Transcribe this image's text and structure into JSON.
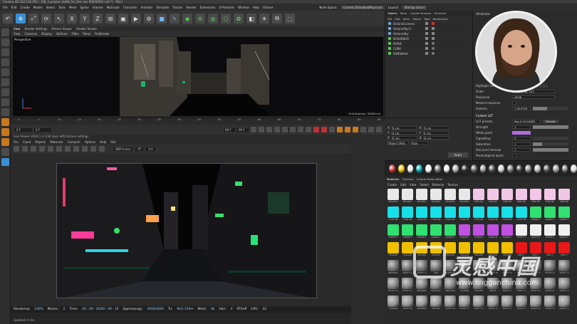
{
  "window": {
    "title": "Cinema 4D S22.116 (RC) - [08_3_project_Vol08_for_Dec.aec 00000002.c4d *] - Main"
  },
  "menubar": {
    "items": [
      "File",
      "Edit",
      "Create",
      "Modes",
      "Select",
      "Tools",
      "Mesh",
      "Spline",
      "Volume",
      "MoGraph",
      "Character",
      "Animate",
      "Simulate",
      "Tracker",
      "Render",
      "Extensions",
      "O-Particles",
      "Window",
      "Help",
      "Octane"
    ],
    "right": [
      "Node Space:",
      "Current (Standard/Physical)",
      "Layout:",
      "Startup (User)"
    ]
  },
  "viewport": {
    "tabs": [
      "View",
      "Render Settings",
      "Picture Viewer",
      "Shader Viewer"
    ],
    "menu": [
      "View",
      "Cameras",
      "Display",
      "Options",
      "Filter",
      "Panel",
      "ProRender"
    ],
    "label": "Perspective",
    "grid_spacing": "Grid Spacing : 50000 cm"
  },
  "timeline": {
    "ticks": [
      "0",
      "5",
      "10",
      "15",
      "20",
      "25",
      "30",
      "35",
      "40",
      "45",
      "50",
      "55",
      "60",
      "65",
      "70",
      "75",
      "80",
      "85",
      "90"
    ],
    "start": "0 F",
    "current": "0 F",
    "end": "90 F",
    "end2": "90 F"
  },
  "live_viewer": {
    "title": "Live Viewer 2020.1.4 (234 days left)    Octane settings",
    "menu": [
      "File",
      "Cloud",
      "Objects",
      "Materials",
      "Compare",
      "Options",
      "Help",
      "GUI"
    ],
    "mode": "HDR linear",
    "pt": "PT",
    "val": "0.6"
  },
  "status": {
    "rendering_label": "Rendering:",
    "rendering": "100%",
    "mssec_label": "Ms/sec:",
    "mssec": "0",
    "time_label": "Time:",
    "time": "00 : 09 : 26/00 : 09 : 26",
    "spp_label": "Spp/maxspp:",
    "spp": "4000/4000",
    "tri_label": "Tri:",
    "tri": "9k/1.529m",
    "mesh_label": "Mesh:",
    "mesh": "8k",
    "hair_label": "Hair:",
    "hair": "0",
    "rtx_label": "RTXoff",
    "gpu_label": "GPU:",
    "gpu": "82",
    "footer": "Updated: 0 ms."
  },
  "objects": {
    "tabs": [
      "Objects",
      "Takes",
      "Content Browser",
      "Structure"
    ],
    "menu": [
      "File",
      "Edit",
      "View",
      "Object",
      "Tags",
      "Bookmarks"
    ],
    "rows": [
      {
        "name": "OctaneCamera"
      },
      {
        "name": "OctaneSky:1"
      },
      {
        "name": "OctaneSky"
      },
      {
        "name": "BUILDINGS"
      },
      {
        "name": "ROAD"
      },
      {
        "name": "CUBE"
      },
      {
        "name": "SIDEWALK"
      }
    ]
  },
  "attributes": {
    "title": "Attributes",
    "rows": [
      {
        "label": "Highlight compression",
        "value": ""
      },
      {
        "label": "Order",
        "value": "Response, LUT"
      },
      {
        "label": "Response",
        "value": "sRGB"
      },
      {
        "label": "Neutral response",
        "value": ""
      },
      {
        "label": "Gamma",
        "value": "1.034706"
      },
      {
        "label": "Custom LUT",
        "value": ""
      },
      {
        "label": "LUT presets",
        "value": "Box 8 HLG/SDR"
      },
      {
        "label": "Strength",
        "value": "1"
      },
      {
        "label": "White point",
        "value": ""
      },
      {
        "label": "Vignetting",
        "value": "0"
      },
      {
        "label": "Saturation",
        "value": "1"
      },
      {
        "label": "Hot pixel removal",
        "value": "1"
      },
      {
        "label": "Premultiplied alpha",
        "value": ""
      }
    ],
    "reload": "Reload"
  },
  "coords": {
    "rows": [
      [
        "X",
        "0 cm",
        "X",
        "0 cm",
        "H",
        "0 °"
      ],
      [
        "Y",
        "0 cm",
        "Y",
        "0 cm",
        "P",
        "0 °"
      ],
      [
        "Z",
        "0 cm",
        "Z",
        "0 cm",
        "B",
        "0 °"
      ]
    ],
    "object_rel": "Object (Rel)",
    "size": "Size",
    "apply": "Apply"
  },
  "materials": {
    "tabs": [
      "Materials",
      "Timeline",
      "Octane Node editor"
    ],
    "menu": [
      "Create",
      "Edit",
      "View",
      "Select",
      "Material",
      "Texture"
    ],
    "rows": [
      {
        "color": "#e8e8e8",
        "names": [
          "BILLBOA",
          "BILLBOA",
          "BILLBOA",
          "BILLBOA",
          "BILLBOA",
          "BILLBOA",
          "PINK Ne",
          "PINK NE",
          "PINK NE",
          "PINK NE",
          "PINK NE",
          "PINK NE",
          "PINK NE"
        ]
      },
      {
        "color": "#18e0e8",
        "names": [
          "CYAN NE",
          "CYAN NE",
          "CYAN NE",
          "CYAN NE",
          "CYAN NE",
          "CYAN NE",
          "CYAN NE",
          "CYAN NE",
          "CYAN NE",
          "CYAN NE",
          "GREEN F",
          "GREEN F",
          "GREEN F"
        ]
      },
      {
        "color": "#30e070",
        "names": [
          "GREEN F",
          "GREEN F",
          "GREEN F",
          "GREEN F",
          "GREEN F",
          "PURPLE",
          "PURPLE",
          "PURPLE",
          "PURPLE",
          "WHITE F",
          "WHITE F",
          "WHITE F",
          "WHITE F"
        ]
      },
      {
        "color": "#f0c000",
        "names": [
          "YELLOW",
          "YELLOW",
          "YELLOW",
          "YELLOW",
          "YELLOW",
          "YELLOW",
          "YELLOW",
          "YELLOW",
          "YELLOW",
          "RED 1",
          "RED 1",
          "RED 1",
          "RED 1"
        ]
      },
      {
        "color": "#777777",
        "names": [
          "WOOD01",
          "RUSTY A",
          "RUSTY S",
          "Mat",
          "RUSTY N",
          "RUSTY T",
          "RUSTY A",
          "RUSTY B",
          "RUSTY S",
          "RUSTY F",
          "RUSTY O",
          "RUSTY R",
          "RUSTY S"
        ]
      },
      {
        "color": "#888888",
        "names": [
          "RUSTY G",
          "RUSTY C",
          "ANDREW",
          "WOOD01",
          "WOOD09",
          "ALUMIN",
          "PLASTIC",
          "METAL",
          "RUSTY F",
          "RUSTY S",
          "RUSTY R",
          "RUSTY R",
          "RUSTY S"
        ]
      },
      {
        "color": "#999999",
        "names": [
          "CONCRE",
          "RUSTY B",
          "ANDREW",
          "CNC PAI",
          "RUSTY N",
          "RUSTY T",
          "RUSTY A",
          "RUSTY 1",
          "RUSTY F",
          "RUSTY F",
          "RUSTY R",
          "RUSTY S",
          "RUSTY S"
        ]
      }
    ]
  },
  "watermark": {
    "text": "灵感中国",
    "url": "www.lingganchina.com"
  },
  "colors": {
    "accent": "#3a8fd6",
    "bg": "#2b2b2b",
    "render_sky": "#050506"
  }
}
